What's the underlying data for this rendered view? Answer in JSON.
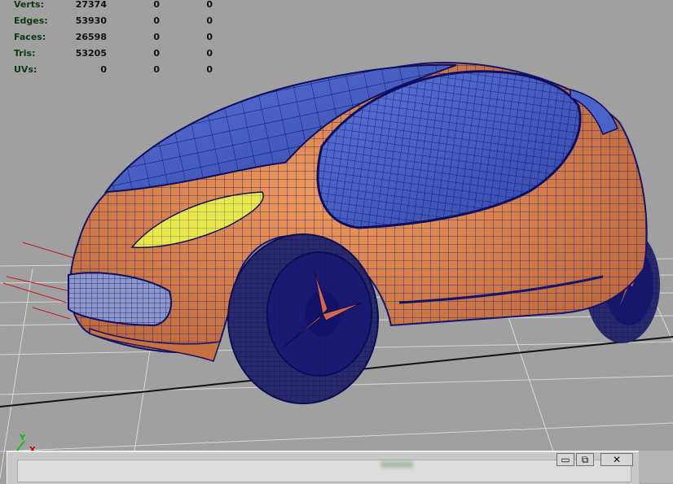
{
  "hud": {
    "rows": [
      {
        "label": "Verts:",
        "v1": "27374",
        "v2": "0",
        "v3": "0"
      },
      {
        "label": "Edges:",
        "v1": "53930",
        "v2": "0",
        "v3": "0"
      },
      {
        "label": "Faces:",
        "v1": "26598",
        "v2": "0",
        "v3": "0"
      },
      {
        "label": "Tris:",
        "v1": "53205",
        "v2": "0",
        "v3": "0"
      },
      {
        "label": "UVs:",
        "v1": "0",
        "v2": "0",
        "v3": "0"
      }
    ]
  },
  "axis": {
    "y": "Y",
    "x": "X"
  },
  "window_buttons": {
    "minimize": "▭",
    "restore": "⧉",
    "close": "✕"
  },
  "colors": {
    "background": "#a0a0a0",
    "body": "#e08a4e",
    "glass": "#4a63c8",
    "headlight": "#e8e84a",
    "wire": "#1a1a7a",
    "tire": "#2a2a6a"
  }
}
